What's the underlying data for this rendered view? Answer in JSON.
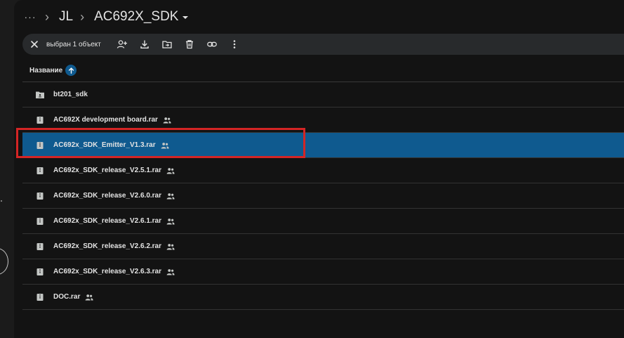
{
  "breadcrumb": {
    "more": "···",
    "items": [
      "JL"
    ],
    "current": "AC692X_SDK"
  },
  "toolbar": {
    "selection_text": "выбран 1 объект",
    "icons": [
      "close-icon",
      "share-icon",
      "download-icon",
      "move-icon",
      "delete-icon",
      "link-icon",
      "more-vert-icon"
    ]
  },
  "header": {
    "name_column": "Название",
    "sort_direction": "ascending"
  },
  "files": [
    {
      "name": "bt201_sdk",
      "type": "folder",
      "shared": false,
      "selected": false
    },
    {
      "name": "AC692X development board.rar",
      "type": "archive",
      "shared": true,
      "selected": false
    },
    {
      "name": "AC692x_SDK_Emitter_V1.3.rar",
      "type": "archive",
      "shared": true,
      "selected": true
    },
    {
      "name": "AC692x_SDK_release_V2.5.1.rar",
      "type": "archive",
      "shared": true,
      "selected": false
    },
    {
      "name": "AC692x_SDK_release_V2.6.0.rar",
      "type": "archive",
      "shared": true,
      "selected": false
    },
    {
      "name": "AC692x_SDK_release_V2.6.1.rar",
      "type": "archive",
      "shared": true,
      "selected": false
    },
    {
      "name": "AC692x_SDK_release_V2.6.2.rar",
      "type": "archive",
      "shared": true,
      "selected": false
    },
    {
      "name": "AC692x_SDK_release_V2.6.3.rar",
      "type": "archive",
      "shared": true,
      "selected": false
    },
    {
      "name": "DOC.rar",
      "type": "archive",
      "shared": true,
      "selected": false
    }
  ],
  "colors": {
    "selected_row": "#0f5a8f",
    "highlight": "#d42525",
    "background": "#131313"
  }
}
